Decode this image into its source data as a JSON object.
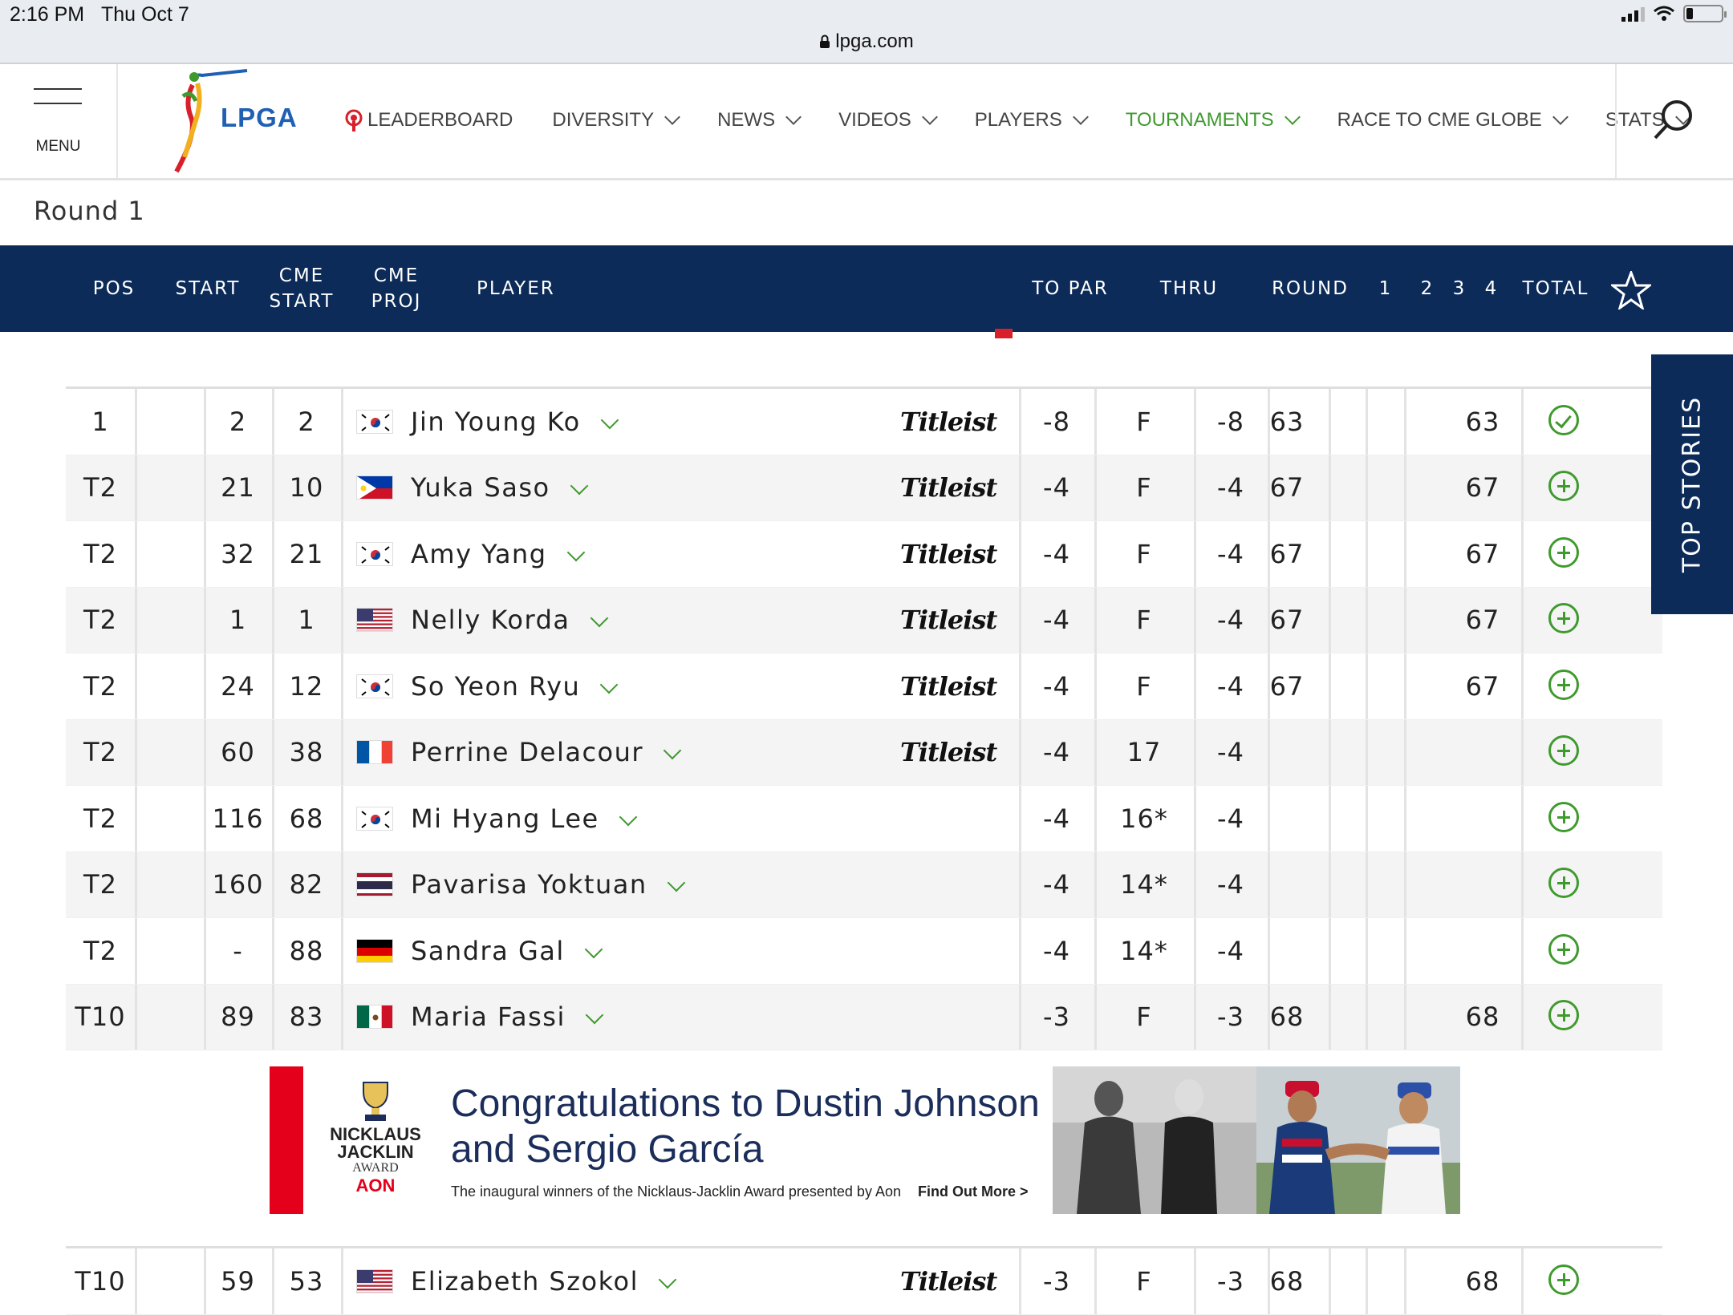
{
  "status_bar": {
    "time": "2:16 PM",
    "date": "Thu Oct 7",
    "url": "lpga.com"
  },
  "header": {
    "menu_label": "MENU",
    "logo_text": "LPGA",
    "nav": [
      {
        "label": "LEADERBOARD",
        "icon": "broadcast-pin-icon",
        "dropdown": false,
        "active": false
      },
      {
        "label": "DIVERSITY",
        "dropdown": true,
        "active": false
      },
      {
        "label": "NEWS",
        "dropdown": true,
        "active": false
      },
      {
        "label": "VIDEOS",
        "dropdown": true,
        "active": false
      },
      {
        "label": "PLAYERS",
        "dropdown": true,
        "active": false
      },
      {
        "label": "TOURNAMENTS",
        "dropdown": true,
        "active": true
      },
      {
        "label": "RACE TO CME GLOBE",
        "dropdown": true,
        "active": false
      },
      {
        "label": "STATS",
        "dropdown": true,
        "active": false
      }
    ],
    "search_icon": "search-icon"
  },
  "round_title": "Round 1",
  "table_header": {
    "pos": "POS",
    "start": "START",
    "cme_start_1": "CME",
    "cme_start_2": "START",
    "cme_proj_1": "CME",
    "cme_proj_2": "PROJ",
    "player": "PLAYER",
    "to_par": "TO PAR",
    "thru": "THRU",
    "round": "ROUND",
    "r1": "1",
    "r2": "2",
    "r3": "3",
    "r4": "4",
    "total": "TOTAL"
  },
  "rows": [
    {
      "pos": "1",
      "start": "",
      "cme_start": "2",
      "cme_proj": "2",
      "flag": "KOR",
      "player": "Jin Young Ko",
      "sponsor": "Titleist",
      "to_par": "-8",
      "thru": "F",
      "round": "-8",
      "r1": "63",
      "total": "63",
      "favorite": true
    },
    {
      "pos": "T2",
      "start": "",
      "cme_start": "21",
      "cme_proj": "10",
      "flag": "PHI",
      "player": "Yuka Saso",
      "sponsor": "Titleist",
      "to_par": "-4",
      "thru": "F",
      "round": "-4",
      "r1": "67",
      "total": "67",
      "favorite": false
    },
    {
      "pos": "T2",
      "start": "",
      "cme_start": "32",
      "cme_proj": "21",
      "flag": "KOR",
      "player": "Amy Yang",
      "sponsor": "Titleist",
      "to_par": "-4",
      "thru": "F",
      "round": "-4",
      "r1": "67",
      "total": "67",
      "favorite": false
    },
    {
      "pos": "T2",
      "start": "",
      "cme_start": "1",
      "cme_proj": "1",
      "flag": "USA",
      "player": "Nelly Korda",
      "sponsor": "Titleist",
      "to_par": "-4",
      "thru": "F",
      "round": "-4",
      "r1": "67",
      "total": "67",
      "favorite": false
    },
    {
      "pos": "T2",
      "start": "",
      "cme_start": "24",
      "cme_proj": "12",
      "flag": "KOR",
      "player": "So Yeon Ryu",
      "sponsor": "Titleist",
      "to_par": "-4",
      "thru": "F",
      "round": "-4",
      "r1": "67",
      "total": "67",
      "favorite": false
    },
    {
      "pos": "T2",
      "start": "",
      "cme_start": "60",
      "cme_proj": "38",
      "flag": "FRA",
      "player": "Perrine Delacour",
      "sponsor": "Titleist",
      "to_par": "-4",
      "thru": "17",
      "round": "-4",
      "r1": "",
      "total": "",
      "favorite": false
    },
    {
      "pos": "T2",
      "start": "",
      "cme_start": "116",
      "cme_proj": "68",
      "flag": "KOR",
      "player": "Mi Hyang Lee",
      "sponsor": "",
      "to_par": "-4",
      "thru": "16*",
      "round": "-4",
      "r1": "",
      "total": "",
      "favorite": false
    },
    {
      "pos": "T2",
      "start": "",
      "cme_start": "160",
      "cme_proj": "82",
      "flag": "THA",
      "player": "Pavarisa Yoktuan",
      "sponsor": "",
      "to_par": "-4",
      "thru": "14*",
      "round": "-4",
      "r1": "",
      "total": "",
      "favorite": false
    },
    {
      "pos": "T2",
      "start": "",
      "cme_start": "-",
      "cme_proj": "88",
      "flag": "GER",
      "player": "Sandra Gal",
      "sponsor": "",
      "to_par": "-4",
      "thru": "14*",
      "round": "-4",
      "r1": "",
      "total": "",
      "favorite": false
    },
    {
      "pos": "T10",
      "start": "",
      "cme_start": "89",
      "cme_proj": "83",
      "flag": "MEX",
      "player": "Maria Fassi",
      "sponsor": "",
      "to_par": "-3",
      "thru": "F",
      "round": "-3",
      "r1": "68",
      "total": "68",
      "favorite": false
    }
  ],
  "rows_after_ad": [
    {
      "pos": "T10",
      "start": "",
      "cme_start": "59",
      "cme_proj": "53",
      "flag": "USA",
      "player": "Elizabeth Szokol",
      "sponsor": "Titleist",
      "to_par": "-3",
      "thru": "F",
      "round": "-3",
      "r1": "68",
      "total": "68",
      "favorite": false
    }
  ],
  "ad": {
    "award_line1": "NICKLAUS",
    "award_line2": "JACKLIN",
    "award_line3": "AWARD",
    "award_sponsor": "AON",
    "headline_1": "Congratulations to Dustin Johnson",
    "headline_2": "and Sergio García",
    "subtext": "The inaugural winners of the Nicklaus-Jacklin Award presented by Aon",
    "cta": "Find Out More >"
  },
  "top_stories_label": "TOP STORIES",
  "colors": {
    "navy": "#0c2b59",
    "green": "#3f9a2e",
    "ad_red": "#e4001b"
  }
}
